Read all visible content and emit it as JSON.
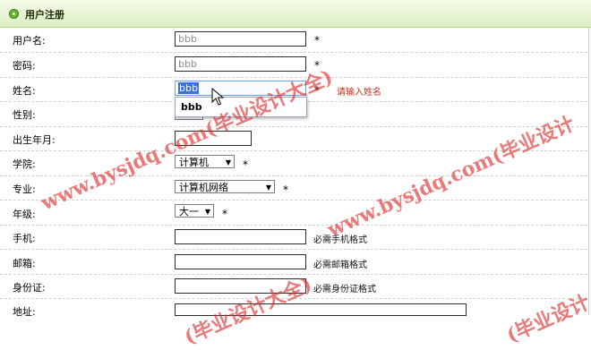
{
  "header": {
    "title": "用户注册"
  },
  "form": {
    "username": {
      "label": "用户名:",
      "value": "bbb",
      "required": "*"
    },
    "password": {
      "label": "密码:",
      "value": "bbb",
      "required": "*"
    },
    "name": {
      "label": "姓名:",
      "value": "bbb",
      "required": "*",
      "error": "请输入姓名"
    },
    "gender": {
      "label": "性别:"
    },
    "birth": {
      "label": "出生年月:",
      "value": ""
    },
    "college": {
      "label": "学院:",
      "selected": "计算机",
      "required": "*"
    },
    "major": {
      "label": "专业:",
      "selected": "计算机网络",
      "required": "*"
    },
    "grade": {
      "label": "年级:",
      "selected": "大一",
      "required": "*"
    },
    "phone": {
      "label": "手机:",
      "value": "",
      "hint": "必需手机格式"
    },
    "email": {
      "label": "邮箱:",
      "value": "",
      "hint": "必需邮箱格式"
    },
    "idcard": {
      "label": "身份证:",
      "value": "",
      "hint": "必需身份证格式"
    },
    "address": {
      "label": "地址:",
      "value": ""
    }
  },
  "autocomplete": {
    "suggestion": "bbb"
  },
  "watermarks": [
    "www.bysjdq.com(毕业设计大全)",
    "www.bysjdq.com(毕业设计",
    "(毕业设计大全)",
    "(毕业设计"
  ],
  "colors": {
    "accent": "#6ab52a",
    "error": "#c0321e",
    "watermark": "#dc2828"
  },
  "icons": [
    "circle-bullet-icon",
    "mouse-pointer-icon",
    "dropdown-arrow-icon"
  ]
}
